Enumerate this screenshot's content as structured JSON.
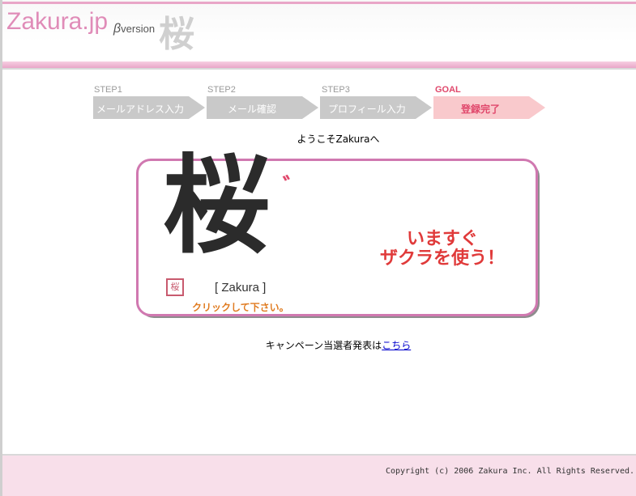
{
  "header": {
    "logo_text": "Zakura.jp",
    "beta_symbol": "β",
    "beta_text": "version",
    "decor_kanji": "桜"
  },
  "steps": [
    {
      "label": "STEP1",
      "text": "メールアドレス入力",
      "state": "done"
    },
    {
      "label": "STEP2",
      "text": "メール確認",
      "state": "done"
    },
    {
      "label": "STEP3",
      "text": "プロフィール入力",
      "state": "done"
    },
    {
      "label": "GOAL",
      "text": "登録完了",
      "state": "current"
    }
  ],
  "welcome_text": "ようこそZakuraへ",
  "banner": {
    "kanji": "桜",
    "kanji_accent": "゛",
    "stamp": "桜",
    "name": "[ Zakura ]",
    "click_text": "クリックして下さい。",
    "cta_line1": "いますぐ",
    "cta_line2": "ザクラを使う！"
  },
  "campaign": {
    "text": "キャンペーン当選者発表は",
    "link": "こちら"
  },
  "footer": {
    "copyright": "Copyright (c) 2006 Zakura Inc. All Rights Reserved."
  },
  "colors": {
    "accent_pink": "#e08cb8",
    "goal_red": "#e0476b",
    "step_gray": "#c9c9c9",
    "cta_red": "#e03a3a",
    "footer_bg": "#f8dfea"
  }
}
